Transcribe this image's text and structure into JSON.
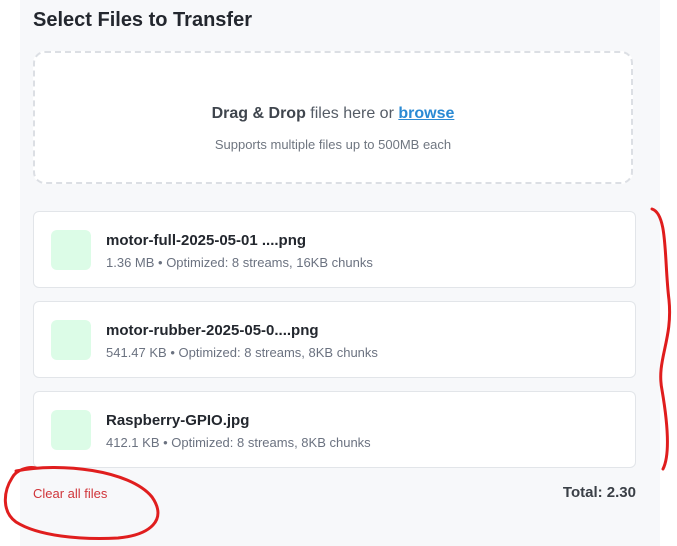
{
  "section": {
    "title": "Select Files to Transfer"
  },
  "dropzone": {
    "strong_text": "Drag & Drop",
    "middle_text": " files here or ",
    "browse_label": "browse",
    "subtitle": "Supports multiple files up to 500MB each"
  },
  "files": [
    {
      "name": "motor-full-2025-05-01 ....png",
      "meta": "1.36 MB • Optimized: 8 streams, 16KB chunks"
    },
    {
      "name": "motor-rubber-2025-05-0....png",
      "meta": "541.47 KB • Optimized: 8 streams, 8KB chunks"
    },
    {
      "name": "Raspberry-GPIO.jpg",
      "meta": "412.1 KB • Optimized: 8 streams, 8KB chunks"
    }
  ],
  "footer": {
    "clear_label": "Clear all files",
    "total_label": "Total: 2.30"
  },
  "colors": {
    "thumb": "#dcfce7",
    "link": "#2a8ad4",
    "clear": "#d0353a",
    "annotation": "#e01e1e"
  }
}
